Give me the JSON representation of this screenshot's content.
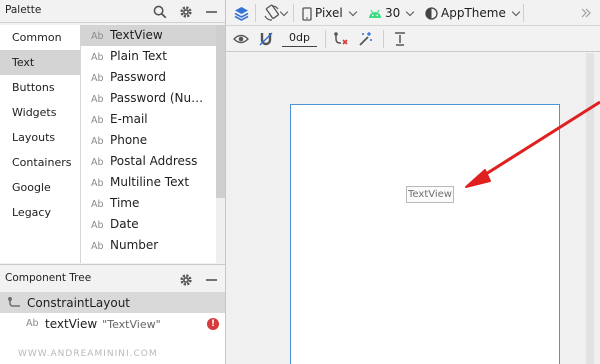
{
  "palette": {
    "title": "Palette",
    "categories": [
      "Common",
      "Text",
      "Buttons",
      "Widgets",
      "Layouts",
      "Containers",
      "Google",
      "Legacy"
    ],
    "selected_category": "Text",
    "widget_icon_text": "Ab",
    "widgets": [
      "TextView",
      "Plain Text",
      "Password",
      "Password (Nu…",
      "E-mail",
      "Phone",
      "Postal Address",
      "Multiline Text",
      "Time",
      "Date",
      "Number"
    ],
    "selected_widget": "TextView"
  },
  "component_tree": {
    "title": "Component Tree",
    "root": {
      "label": "ConstraintLayout"
    },
    "child": {
      "icon_text": "Ab",
      "label": "textView",
      "text_value": "\"TextView\"",
      "error_badge": "!"
    }
  },
  "toolbar": {
    "device": "Pixel",
    "api_level": "30",
    "theme": "AppTheme",
    "default_margin": "0dp"
  },
  "canvas": {
    "textview_text": "TextView"
  },
  "watermark": "WWW.ANDREAMININI.COM",
  "colors": {
    "annotation_arrow": "#e02020",
    "selection_background": "#d4d4d4",
    "error": "#d73a3a",
    "frame_border": "#4f93d8",
    "android_green": "#3ddc84"
  },
  "icons": [
    "search-icon",
    "gear-icon",
    "minimize-icon",
    "layers-icon",
    "orientation-icon",
    "device-icon",
    "android-icon",
    "theme-icon",
    "chevron-right-icon",
    "eye-icon",
    "magnet-icon",
    "clear-constraints-icon",
    "infer-constraints-icon",
    "align-icon",
    "constraint-layout-icon",
    "error-icon"
  ]
}
